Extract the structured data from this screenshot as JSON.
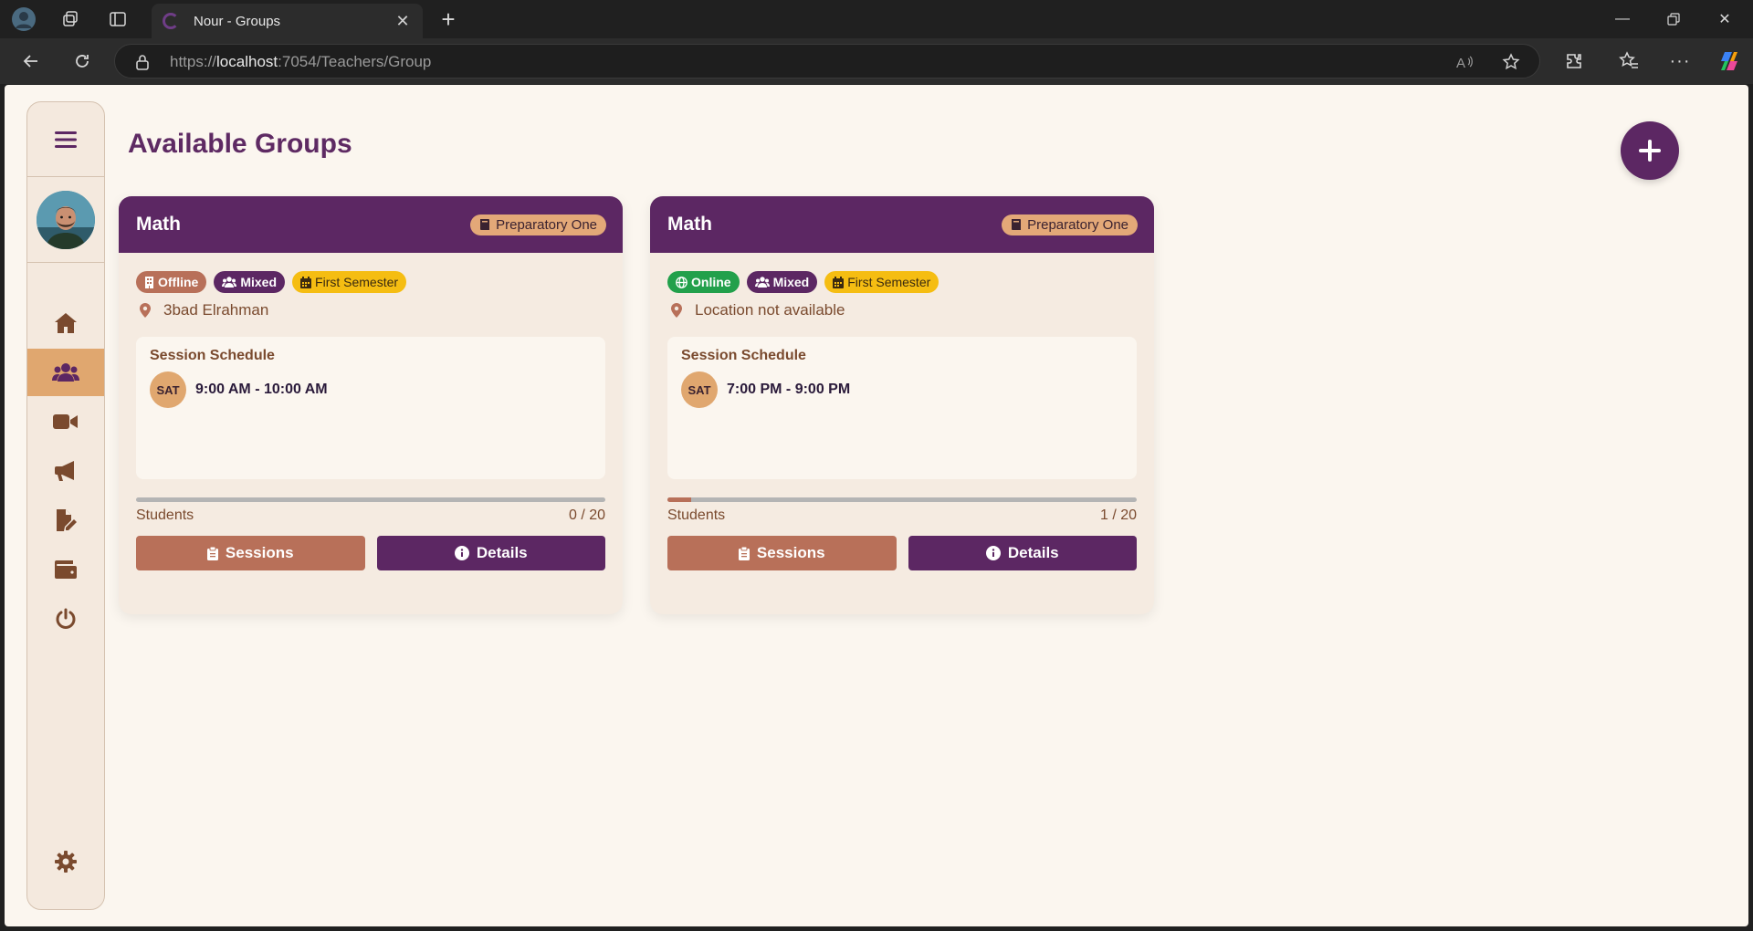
{
  "browser": {
    "tab_title": "Nour - Groups",
    "url_prefix": "https://",
    "url_host": "localhost",
    "url_rest": ":7054/Teachers/Group"
  },
  "page": {
    "title": "Available Groups"
  },
  "colors": {
    "primary": "#5c2763",
    "accent": "#e0a76f",
    "terracotta": "#b87059",
    "online": "#22a04b",
    "semester": "#f5bd12"
  },
  "sidebar": {
    "items": [
      {
        "name": "home",
        "icon": "home-icon"
      },
      {
        "name": "groups",
        "icon": "users-icon",
        "active": true
      },
      {
        "name": "video",
        "icon": "video-icon"
      },
      {
        "name": "announcements",
        "icon": "megaphone-icon"
      },
      {
        "name": "exams",
        "icon": "file-edit-icon"
      },
      {
        "name": "wallet",
        "icon": "wallet-icon"
      },
      {
        "name": "logout",
        "icon": "power-icon"
      },
      {
        "name": "settings",
        "icon": "gear-icon"
      }
    ]
  },
  "groups": [
    {
      "subject": "Math",
      "grade": "Preparatory One",
      "mode": "Offline",
      "gender": "Mixed",
      "semester": "First Semester",
      "location": "3bad Elrahman",
      "schedule_title": "Session Schedule",
      "day": "SAT",
      "time": "9:00 AM - 10:00 AM",
      "students_label": "Students",
      "students_count": "0 / 20",
      "students_fraction": 0.0,
      "sessions_label": "Sessions",
      "details_label": "Details"
    },
    {
      "subject": "Math",
      "grade": "Preparatory One",
      "mode": "Online",
      "gender": "Mixed",
      "semester": "First Semester",
      "location": "Location not available",
      "schedule_title": "Session Schedule",
      "day": "SAT",
      "time": "7:00 PM - 9:00 PM",
      "students_label": "Students",
      "students_count": "1 / 20",
      "students_fraction": 0.05,
      "sessions_label": "Sessions",
      "details_label": "Details"
    }
  ]
}
